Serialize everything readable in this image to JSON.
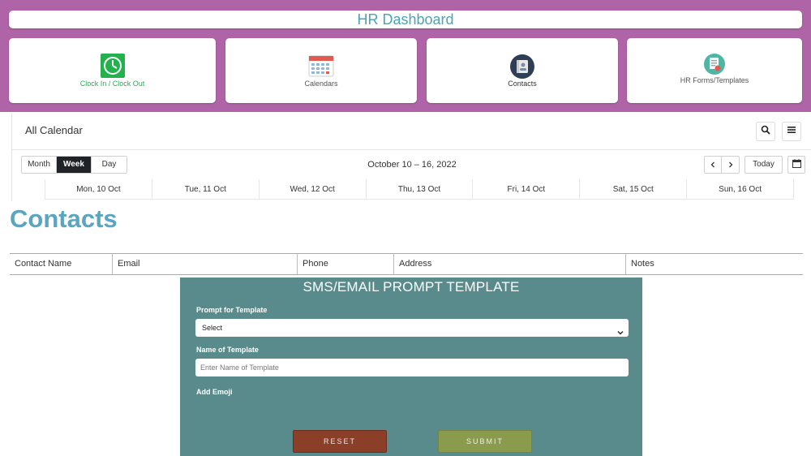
{
  "header": {
    "title": "HR Dashboard"
  },
  "tiles": [
    {
      "label": "Clock In / Clock Out",
      "icon": "clock-icon",
      "color": "#22b14c"
    },
    {
      "label": "Calendars",
      "icon": "calendar-icon",
      "color": "#555555"
    },
    {
      "label": "Contacts",
      "icon": "contacts-book-icon",
      "color": "#333333"
    },
    {
      "label": "HR Forms/Templates",
      "icon": "forms-icon",
      "color": "#555555"
    }
  ],
  "calendar": {
    "title": "All Calendar",
    "views": [
      "Month",
      "Week",
      "Day"
    ],
    "active_view": "Week",
    "date_range": "October 10 – 16, 2022",
    "today_label": "Today",
    "days": [
      "Mon, 10 Oct",
      "Tue, 11 Oct",
      "Wed, 12 Oct",
      "Thu, 13 Oct",
      "Fri, 14 Oct",
      "Sat, 15 Oct",
      "Sun, 16 Oct"
    ]
  },
  "contacts": {
    "title": "Contacts",
    "columns": [
      "Contact Name",
      "Email",
      "Phone",
      "Address",
      "Notes"
    ]
  },
  "template_form": {
    "title": "SMS/EMAIL PROMPT TEMPLATE",
    "prompt_label": "Prompt for Template",
    "prompt_value": "Select",
    "name_label": "Name of Template",
    "name_placeholder": "Enter Name of Template",
    "emoji_label": "Add Emoji",
    "reset_label": "RESET",
    "submit_label": "SUBMIT"
  },
  "colors": {
    "band": "#b064a8",
    "title_text": "#4aa3b8",
    "contacts_title": "#5aa5c0",
    "panel_bg": "#5a8b8c",
    "reset": "#8c3f28",
    "submit": "#8a9b4d"
  }
}
